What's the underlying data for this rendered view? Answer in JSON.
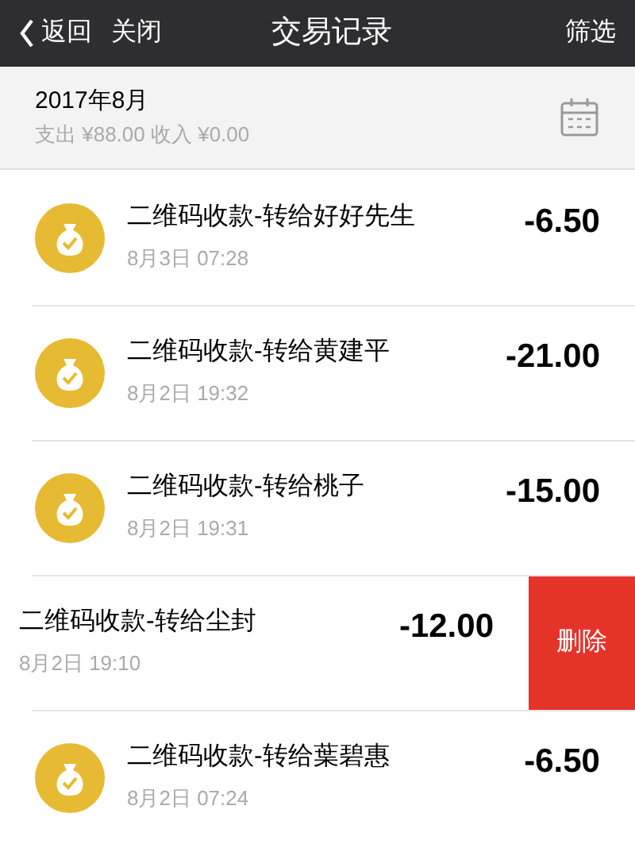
{
  "nav": {
    "back": "返回",
    "close": "关闭",
    "title": "交易记录",
    "filter": "筛选"
  },
  "month": {
    "label": "2017年8月",
    "summary": "支出 ¥88.00 收入 ¥0.00"
  },
  "transactions": [
    {
      "title": "二维码收款-转给好好先生",
      "time": "8月3日 07:28",
      "amount": "-6.50",
      "swiped": false
    },
    {
      "title": "二维码收款-转给黄建平",
      "time": "8月2日 19:32",
      "amount": "-21.00",
      "swiped": false
    },
    {
      "title": "二维码收款-转给桃子",
      "time": "8月2日 19:31",
      "amount": "-15.00",
      "swiped": false
    },
    {
      "title": "二维码收款-转给尘封",
      "time": "8月2日 19:10",
      "amount": "-12.00",
      "swiped": true,
      "action": "删除"
    },
    {
      "title": "二维码收款-转给葉碧惠",
      "time": "8月2日 07:24",
      "amount": "-6.50",
      "swiped": false
    }
  ]
}
